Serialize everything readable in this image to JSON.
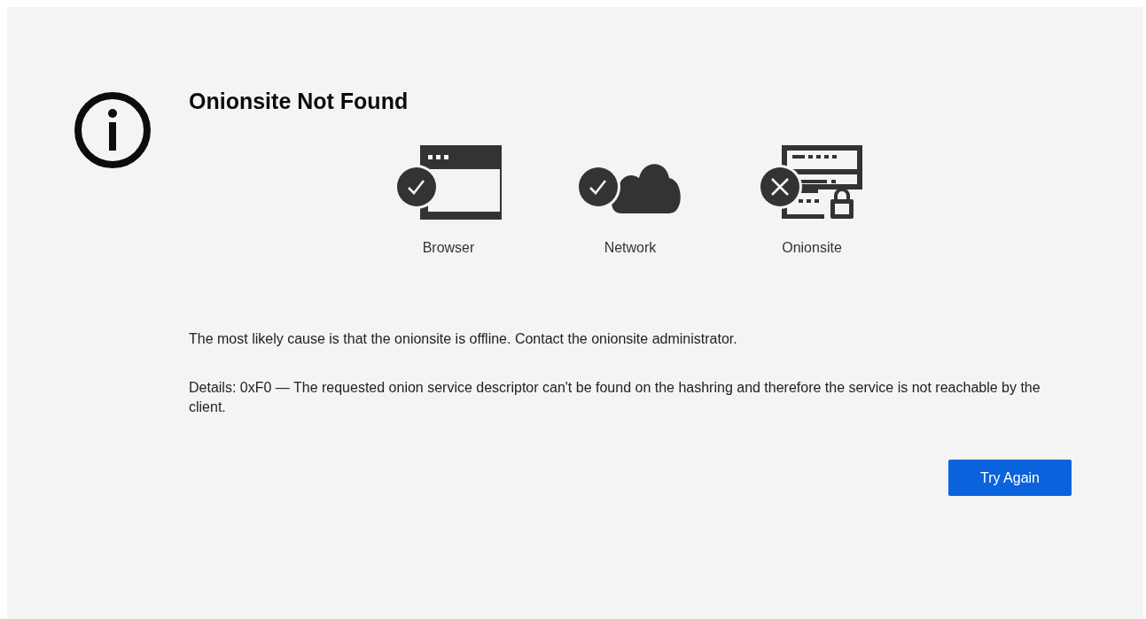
{
  "title": "Onionsite Not Found",
  "checks": [
    {
      "kind": "browser",
      "label": "Browser",
      "ok": true
    },
    {
      "kind": "network",
      "label": "Network",
      "ok": true
    },
    {
      "kind": "onionsite",
      "label": "Onionsite",
      "ok": false
    }
  ],
  "cause": "The most likely cause is that the onionsite is offline. Contact the onionsite administrator.",
  "details": "Details: 0xF0 — The requested onion service descriptor can't be found on the hashring and therefore the service is not reachable by the client.",
  "button": "Try Again"
}
